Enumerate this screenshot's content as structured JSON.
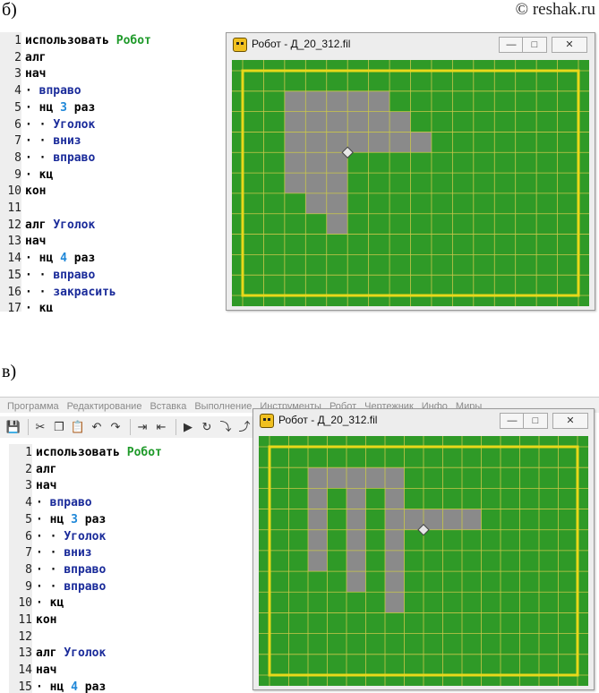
{
  "header": {
    "label_b": "б)",
    "watermark": "© reshak.ru"
  },
  "section_b": {
    "code_lines": [
      {
        "n": "1",
        "parts": [
          [
            "kw",
            "использовать "
          ],
          [
            "lib",
            "Робот"
          ]
        ]
      },
      {
        "n": "2",
        "parts": [
          [
            "kw",
            "алг"
          ]
        ]
      },
      {
        "n": "3",
        "parts": [
          [
            "kw",
            "нач"
          ]
        ]
      },
      {
        "n": "4",
        "parts": [
          [
            "kw",
            "· "
          ],
          [
            "name",
            "вправо"
          ]
        ]
      },
      {
        "n": "5",
        "parts": [
          [
            "kw",
            "· нц "
          ],
          [
            "num",
            "3"
          ],
          [
            "kw",
            " раз"
          ]
        ]
      },
      {
        "n": "6",
        "parts": [
          [
            "kw",
            "· · "
          ],
          [
            "name",
            "Уголок"
          ]
        ]
      },
      {
        "n": "7",
        "parts": [
          [
            "kw",
            "· · "
          ],
          [
            "name",
            "вниз"
          ]
        ]
      },
      {
        "n": "8",
        "parts": [
          [
            "kw",
            "· · "
          ],
          [
            "name",
            "вправо"
          ]
        ]
      },
      {
        "n": "9",
        "parts": [
          [
            "kw",
            "· кц"
          ]
        ]
      },
      {
        "n": "10",
        "parts": [
          [
            "kw",
            "кон"
          ]
        ]
      },
      {
        "n": "11",
        "parts": []
      },
      {
        "n": "12",
        "parts": [
          [
            "kw",
            "алг "
          ],
          [
            "name",
            "Уголок"
          ]
        ]
      },
      {
        "n": "13",
        "parts": [
          [
            "kw",
            "нач"
          ]
        ]
      },
      {
        "n": "14",
        "parts": [
          [
            "kw",
            "· нц "
          ],
          [
            "num",
            "4"
          ],
          [
            "kw",
            " раз"
          ]
        ]
      },
      {
        "n": "15",
        "parts": [
          [
            "kw",
            "· · "
          ],
          [
            "name",
            "вправо"
          ]
        ]
      },
      {
        "n": "16",
        "parts": [
          [
            "kw",
            "· · "
          ],
          [
            "name",
            "закрасить"
          ]
        ]
      },
      {
        "n": "17",
        "parts": [
          [
            "kw",
            "· кц"
          ]
        ]
      }
    ],
    "robot_window": {
      "title": "Робот - Д_20_312.fil",
      "cols": 16,
      "rows": 11,
      "painted": [
        [
          2,
          1
        ],
        [
          3,
          1
        ],
        [
          4,
          1
        ],
        [
          5,
          1
        ],
        [
          6,
          1
        ],
        [
          2,
          2
        ],
        [
          3,
          2
        ],
        [
          4,
          2
        ],
        [
          5,
          2
        ],
        [
          6,
          2
        ],
        [
          7,
          2
        ],
        [
          2,
          3
        ],
        [
          3,
          3
        ],
        [
          4,
          3
        ],
        [
          5,
          3
        ],
        [
          6,
          3
        ],
        [
          7,
          3
        ],
        [
          8,
          3
        ],
        [
          2,
          4
        ],
        [
          3,
          4
        ],
        [
          4,
          4
        ],
        [
          2,
          5
        ],
        [
          3,
          5
        ],
        [
          4,
          5
        ],
        [
          3,
          6
        ],
        [
          4,
          6
        ],
        [
          4,
          7
        ]
      ],
      "robot": [
        5,
        4
      ]
    }
  },
  "section_v": {
    "label": "в)",
    "menu": [
      "Программа",
      "Редактирование",
      "Вставка",
      "Выполнение",
      "Инструменты",
      "Робот",
      "Чертежник",
      "Инфо",
      "Миры"
    ],
    "toolbar_icons": [
      "save-icon",
      "cut-icon",
      "copy-icon",
      "paste-icon",
      "undo-icon",
      "redo-icon",
      "indent-icon",
      "outdent-icon",
      "run-icon",
      "step-icon",
      "step-in-icon",
      "step-out-icon"
    ],
    "code_lines": [
      {
        "n": "1",
        "parts": [
          [
            "kw",
            "использовать "
          ],
          [
            "lib",
            "Робот"
          ]
        ]
      },
      {
        "n": "2",
        "parts": [
          [
            "kw",
            "алг"
          ]
        ]
      },
      {
        "n": "3",
        "parts": [
          [
            "kw",
            "нач"
          ]
        ]
      },
      {
        "n": "4",
        "parts": [
          [
            "kw",
            "· "
          ],
          [
            "name",
            "вправо"
          ]
        ]
      },
      {
        "n": "5",
        "parts": [
          [
            "kw",
            "· нц "
          ],
          [
            "num",
            "3"
          ],
          [
            "kw",
            " раз"
          ]
        ]
      },
      {
        "n": "6",
        "parts": [
          [
            "kw",
            "· · "
          ],
          [
            "name",
            "Уголок"
          ]
        ]
      },
      {
        "n": "7",
        "parts": [
          [
            "kw",
            "· · "
          ],
          [
            "name",
            "вниз"
          ]
        ]
      },
      {
        "n": "8",
        "parts": [
          [
            "kw",
            "· · "
          ],
          [
            "name",
            "вправо"
          ]
        ]
      },
      {
        "n": "9",
        "parts": [
          [
            "kw",
            "· · "
          ],
          [
            "name",
            "вправо"
          ]
        ]
      },
      {
        "n": "10",
        "parts": [
          [
            "kw",
            "· кц"
          ]
        ]
      },
      {
        "n": "11",
        "parts": [
          [
            "kw",
            "кон"
          ]
        ]
      },
      {
        "n": "12",
        "parts": []
      },
      {
        "n": "13",
        "parts": [
          [
            "kw",
            "алг "
          ],
          [
            "name",
            "Уголок"
          ]
        ]
      },
      {
        "n": "14",
        "parts": [
          [
            "kw",
            "нач"
          ]
        ]
      },
      {
        "n": "15",
        "parts": [
          [
            "kw",
            "· нц "
          ],
          [
            "num",
            "4"
          ],
          [
            "kw",
            " раз"
          ]
        ]
      }
    ],
    "robot_window": {
      "title": "Робот - Д_20_312.fil",
      "cols": 16,
      "rows": 11,
      "painted": [
        [
          2,
          1
        ],
        [
          3,
          1
        ],
        [
          4,
          1
        ],
        [
          5,
          1
        ],
        [
          6,
          1
        ],
        [
          2,
          2
        ],
        [
          4,
          2
        ],
        [
          6,
          2
        ],
        [
          2,
          3
        ],
        [
          4,
          3
        ],
        [
          6,
          3
        ],
        [
          7,
          3
        ],
        [
          8,
          3
        ],
        [
          9,
          3
        ],
        [
          10,
          3
        ],
        [
          2,
          4
        ],
        [
          4,
          4
        ],
        [
          6,
          4
        ],
        [
          2,
          5
        ],
        [
          4,
          5
        ],
        [
          6,
          5
        ],
        [
          4,
          6
        ],
        [
          6,
          6
        ],
        [
          6,
          7
        ]
      ],
      "robot": [
        8,
        4
      ]
    }
  },
  "colors": {
    "field_green": "#2f9a27",
    "painted_gray": "#8a8a8a",
    "border_yellow": "#e8d81a",
    "grid_yellow": "#c9c64a"
  }
}
